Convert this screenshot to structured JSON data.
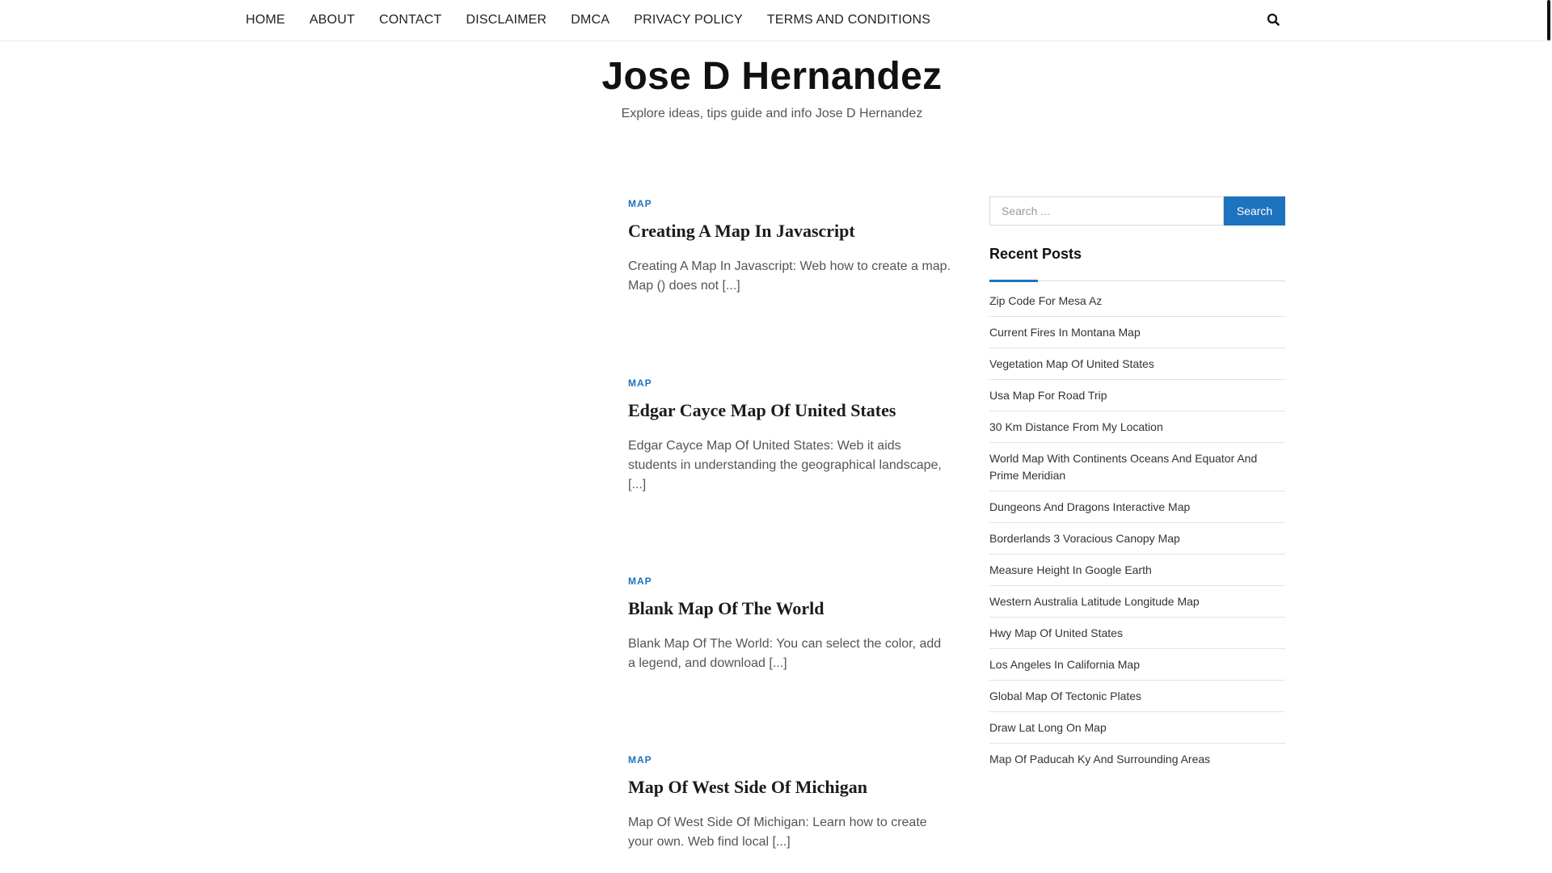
{
  "nav": {
    "items": [
      "HOME",
      "ABOUT",
      "CONTACT",
      "DISCLAIMER",
      "DMCA",
      "PRIVACY POLICY",
      "TERMS AND CONDITIONS"
    ],
    "search_icon": "search-icon"
  },
  "site": {
    "title": "Jose D Hernandez",
    "tagline": "Explore ideas, tips guide and info Jose D Hernandez"
  },
  "posts": [
    {
      "category": "MAP",
      "title": "Creating A Map In Javascript",
      "excerpt": "Creating A Map In Javascript: Web how to create a map. Map () does not [...]"
    },
    {
      "category": "MAP",
      "title": "Edgar Cayce Map Of United States",
      "excerpt": "Edgar Cayce Map Of United States: Web it aids students in understanding the geographical landscape, [...]"
    },
    {
      "category": "MAP",
      "title": "Blank Map Of The World",
      "excerpt": "Blank Map Of The World: You can select the color, add a legend, and download [...]"
    },
    {
      "category": "MAP",
      "title": "Map Of West Side Of Michigan",
      "excerpt": "Map Of West Side Of Michigan: Learn how to create your own. Web find local [...]"
    }
  ],
  "sidebar": {
    "search": {
      "placeholder": "Search ...",
      "button_label": "Search"
    },
    "recent_title": "Recent Posts",
    "recent_posts": [
      "Zip Code For Mesa Az",
      "Current Fires In Montana Map",
      "Vegetation Map Of United States",
      "Usa Map For Road Trip",
      "30 Km Distance From My Location",
      "World Map With Continents Oceans And Equator And Prime Meridian",
      "Dungeons And Dragons Interactive Map",
      "Borderlands 3 Voracious Canopy Map",
      "Measure Height In Google Earth",
      "Western Australia Latitude Longitude Map",
      "Hwy Map Of United States",
      "Los Angeles In California Map",
      "Global Map Of Tectonic Plates",
      "Draw Lat Long On Map",
      "Map Of Paducah Ky And Surrounding Areas"
    ]
  },
  "colors": {
    "accent": "#1e73be",
    "title": "#111111",
    "text": "#555555"
  }
}
